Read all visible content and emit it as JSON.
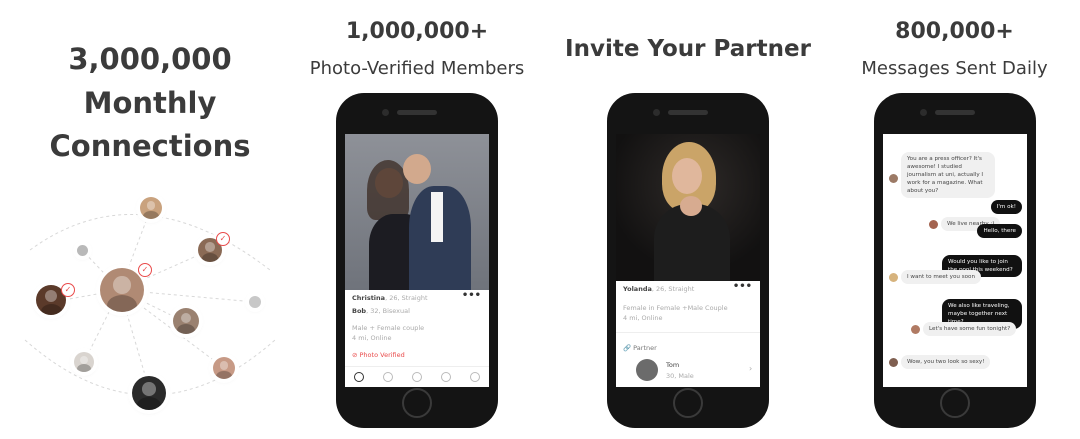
{
  "panels": {
    "p1": {
      "line1": "3,000,000",
      "line2": "Monthly",
      "line3": "Connections"
    },
    "p2": {
      "big": "1,000,000+",
      "sub": "Photo-Verified Members"
    },
    "p3": {
      "big": "Invite Your Partner"
    },
    "p4": {
      "big": "800,000+",
      "sub": "Messages Sent Daily"
    }
  },
  "profile1": {
    "name1": "Christina",
    "meta1": ", 26, Straight",
    "name2": "Bob",
    "meta2": ", 32, Bisexual",
    "desc": "Male + Female couple",
    "status": "4 mi, Online",
    "verified": "Photo Verified",
    "more": "•••"
  },
  "profile2": {
    "name": "Yolanda",
    "meta": ", 26, Straight",
    "desc": "Female in Female +Male Couple",
    "status": "4 mi, Online",
    "partner_label": "Partner",
    "partner_name": "Tom",
    "partner_meta": "30, Male",
    "more": "•••"
  },
  "chat": [
    {
      "dir": "in",
      "text": "You are a press officer? It's awesome! I studied journalism at uni, actually I work for a magazine. What about you?"
    },
    {
      "dir": "out",
      "text": "I'm ok!"
    },
    {
      "dir": "in",
      "text": "We live nearby :)"
    },
    {
      "dir": "out",
      "text": "Hello, there"
    },
    {
      "dir": "out",
      "text": "Would you like to join the pool this weekend?"
    },
    {
      "dir": "in",
      "text": "I want to meet you soon"
    },
    {
      "dir": "out",
      "text": "We also like traveling, maybe together next time?"
    },
    {
      "dir": "in",
      "text": "Let's have some fun tonight?"
    },
    {
      "dir": "in",
      "text": "Wow, you two look so sexy!"
    }
  ],
  "colors": {
    "accent": "#e94b4b",
    "dark": "#141414",
    "bubble_in": "#f0f0f0",
    "bubble_out": "#111111"
  }
}
